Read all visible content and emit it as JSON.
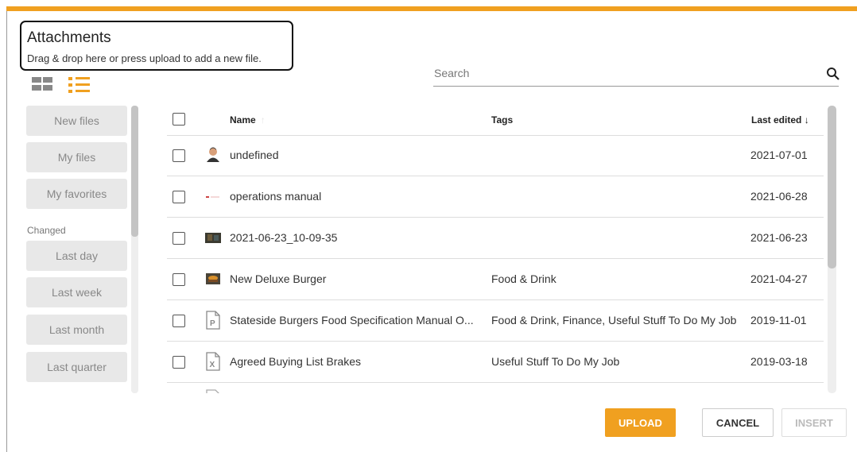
{
  "header": {
    "title": "Attachments",
    "subtitle": "Drag & drop here or press upload to add a new file."
  },
  "view_toggle": {
    "grid_icon": "grid-view-icon",
    "list_icon": "list-view-icon",
    "active": "list"
  },
  "search": {
    "placeholder": "Search",
    "icon": "search-icon"
  },
  "sidebar": {
    "filters": [
      {
        "label": "New files"
      },
      {
        "label": "My files"
      },
      {
        "label": "My favorites"
      }
    ],
    "changed_label": "Changed",
    "changed": [
      {
        "label": "Last day"
      },
      {
        "label": "Last week"
      },
      {
        "label": "Last month"
      },
      {
        "label": "Last quarter"
      }
    ]
  },
  "table": {
    "columns": {
      "name": "Name",
      "tags": "Tags",
      "last_edited": "Last edited"
    },
    "sort_icon": "arrow-down-icon",
    "rows": [
      {
        "icon": "user-avatar-icon",
        "name": "undefined",
        "tags": "",
        "date": "2021-07-01"
      },
      {
        "icon": "document-thumbnail-icon",
        "name": "operations manual",
        "tags": "",
        "date": "2021-06-28"
      },
      {
        "icon": "image-thumbnail-icon",
        "name": "2021-06-23_10-09-35",
        "tags": "",
        "date": "2021-06-23"
      },
      {
        "icon": "burger-image-icon",
        "name": "New Deluxe Burger",
        "tags": "Food & Drink",
        "date": "2021-04-27"
      },
      {
        "icon": "powerpoint-file-icon",
        "name": "Stateside Burgers Food Specification Manual O...",
        "tags": "Food & Drink, Finance, Useful Stuff To Do My Job",
        "date": "2019-11-01"
      },
      {
        "icon": "excel-file-icon",
        "name": "Agreed Buying List Brakes",
        "tags": "Useful Stuff To Do My Job",
        "date": "2019-03-18"
      }
    ]
  },
  "buttons": {
    "upload": "UPLOAD",
    "cancel": "CANCEL",
    "insert": "INSERT"
  },
  "colors": {
    "accent": "#f0a020",
    "button_bg": "#e8e8e8",
    "border": "#dddddd"
  }
}
